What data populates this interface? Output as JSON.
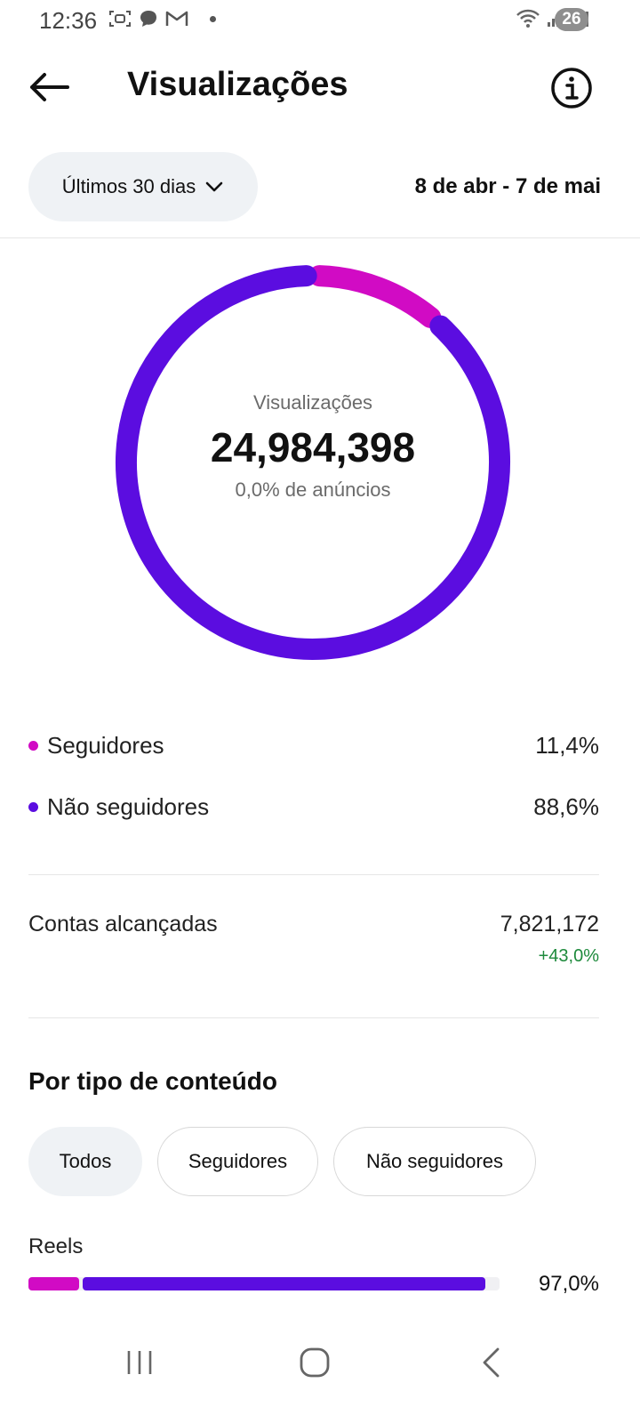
{
  "status_bar": {
    "time": "12:36",
    "battery": "26",
    "left_icons": [
      "screenshot-icon",
      "chat-bubble-icon",
      "gmail-icon",
      "notification-dot"
    ],
    "right_icons": [
      "wifi-icon",
      "signal-icon",
      "signal-icon"
    ]
  },
  "header": {
    "title": "Visualizações",
    "back_icon": "arrow-left-icon",
    "info_icon": "info-icon"
  },
  "filters": {
    "period_label": "Últimos 30 dias",
    "date_range": "8 de abr - 7 de mai"
  },
  "donut": {
    "label": "Visualizações",
    "total": "24,984,398",
    "ads_note": "0,0% de anúncios",
    "segments": [
      {
        "name": "Seguidores",
        "percent": 11.4,
        "color": "#d10bc4"
      },
      {
        "name": "Não seguidores",
        "percent": 88.6,
        "color": "#5b0de0"
      }
    ]
  },
  "legend": [
    {
      "label": "Seguidores",
      "value": "11,4%",
      "color": "#d10bc4"
    },
    {
      "label": "Não seguidores",
      "value": "88,6%",
      "color": "#5b0de0"
    }
  ],
  "reach": {
    "label": "Contas alcançadas",
    "value": "7,821,172",
    "change": "+43,0%",
    "change_color": "#1e8a3c"
  },
  "content_section": {
    "title": "Por tipo de conteúdo",
    "chips": [
      "Todos",
      "Seguidores",
      "Não seguidores"
    ],
    "active_chip": "Todos",
    "rows": [
      {
        "label": "Reels",
        "percent_text": "97,0%",
        "total_fraction": 0.97,
        "followers_fraction": 0.11
      }
    ]
  },
  "colors": {
    "followers": "#d10bc4",
    "non_followers": "#5b0de0",
    "chip_bg": "#eff2f5"
  }
}
